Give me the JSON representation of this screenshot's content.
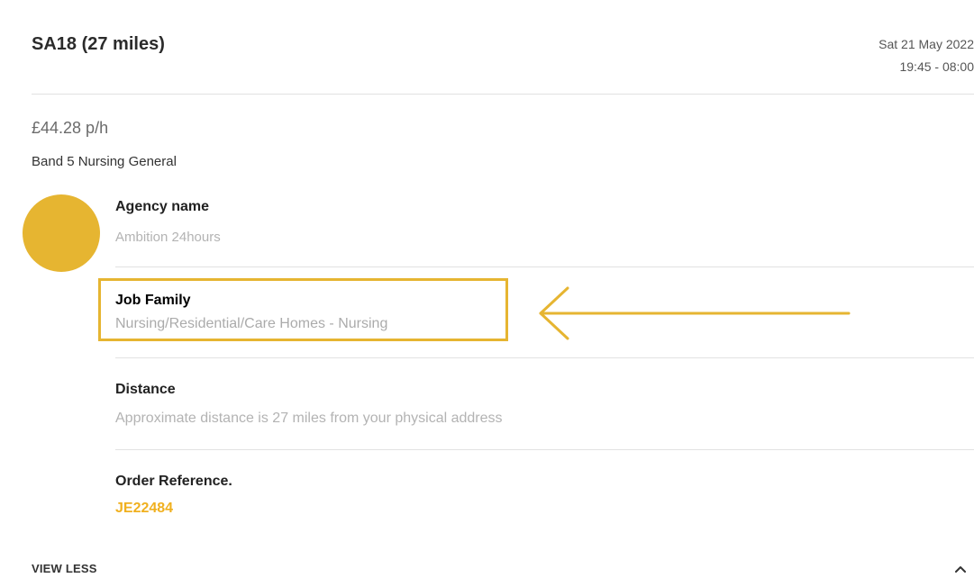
{
  "header": {
    "title": "SA18 (27 miles)",
    "date": "Sat 21 May 2022",
    "time": "19:45 - 08:00"
  },
  "summary": {
    "rate": "£44.28 p/h",
    "band": "Band 5 Nursing General"
  },
  "details": {
    "agency_label": "Agency name",
    "agency_value": "Ambition 24hours",
    "job_family_label": "Job Family",
    "job_family_value": "Nursing/Residential/Care Homes - Nursing",
    "distance_label": "Distance",
    "distance_value": "Approximate distance is 27 miles from your physical address",
    "order_ref_label": "Order Reference.",
    "order_ref_value": "JE22484"
  },
  "footer": {
    "toggle_label": "VIEW LESS"
  },
  "icons": {
    "avatar": "agency-avatar",
    "toggle": "chevron-up-icon",
    "annotation": "arrow-left-icon"
  },
  "colors": {
    "accent": "#e6b531",
    "reference": "#f0b01f"
  }
}
